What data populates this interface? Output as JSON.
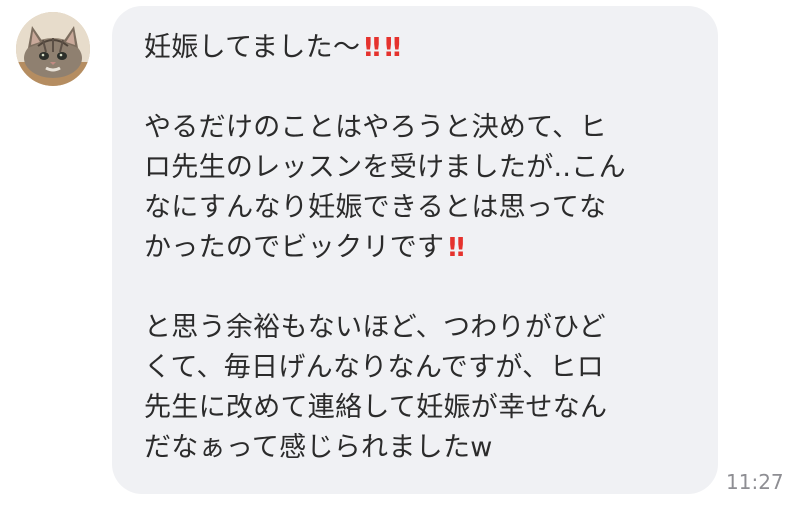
{
  "avatar": {
    "icon": "cat-face-icon"
  },
  "message": {
    "line1_text": "妊娠してました〜",
    "line1_emoji": [
      "‼",
      "‼"
    ],
    "line2": "やるだけのことはやろうと決めて、ヒ",
    "line3": "ロ先生のレッスンを受けましたが..こん",
    "line4": "なにすんなり妊娠できるとは思ってな",
    "line5_text": "かったのでビックリです",
    "line5_emoji": "‼",
    "line6": "と思う余裕もないほど、つわりがひど",
    "line7": "くて、毎日げんなりなんですが、ヒロ",
    "line8": "先生に改めて連絡して妊娠が幸せなん",
    "line9": "だなぁって感じられましたw"
  },
  "timestamp": "11:27",
  "colors": {
    "bubble": "#f0f1f4",
    "text": "#2b2b2b",
    "emoji": "#e5322d",
    "timestamp": "#8e8e93"
  }
}
